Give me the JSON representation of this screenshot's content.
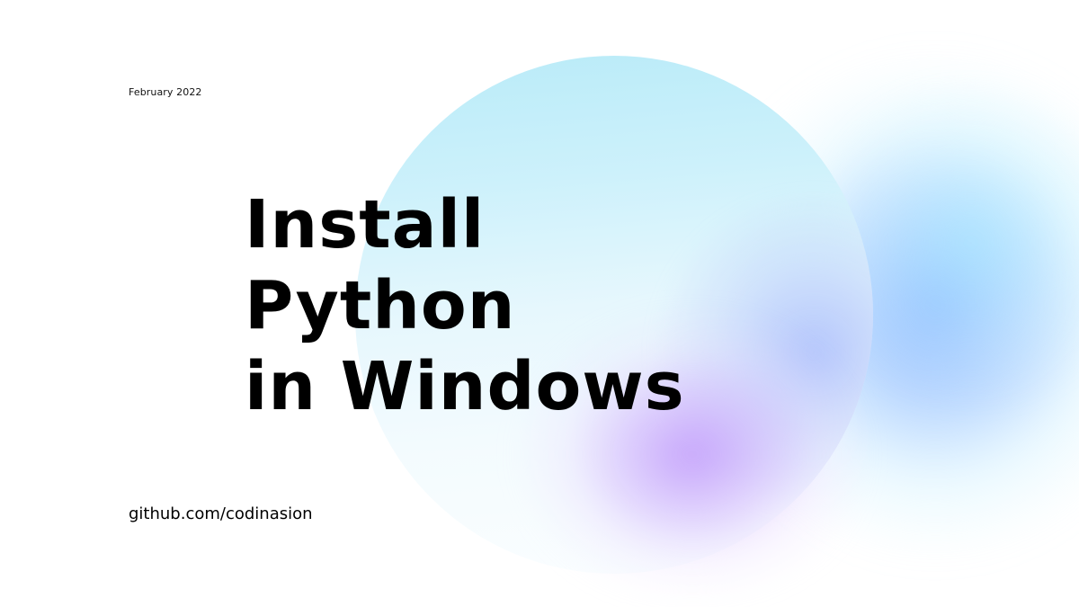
{
  "slide": {
    "date": "February 2022",
    "headline_lines": [
      "Install",
      "Python",
      "in Windows"
    ],
    "footer_link": "github.com/codinasion"
  },
  "colors": {
    "background": "#ffffff",
    "circle_top": "#b9ebf8",
    "circle_bottom": "#fbfeff",
    "blue_glow": "#8cb4ff",
    "purple_glow": "#be96fa",
    "text": "#000000"
  }
}
